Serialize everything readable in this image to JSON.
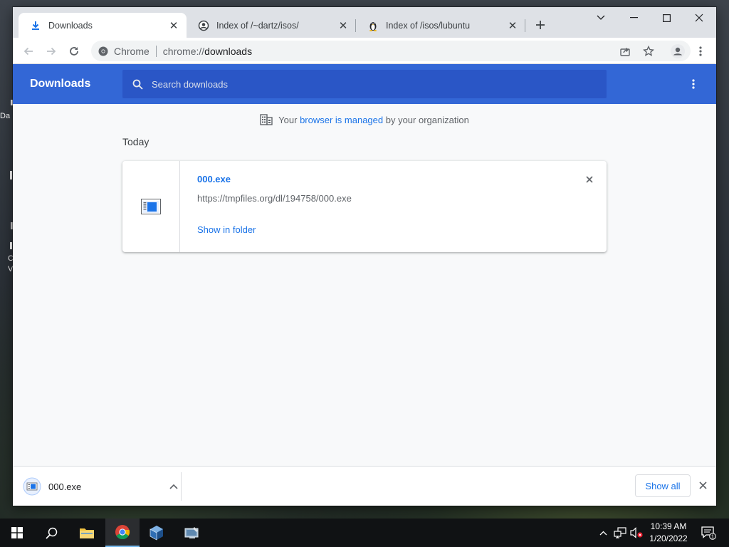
{
  "desktop": {
    "fragments": [
      "Da",
      "C",
      "V"
    ]
  },
  "tabs": [
    {
      "title": "Downloads",
      "icon": "download-icon",
      "active": true
    },
    {
      "title": "Index of /~dartz/isos/",
      "icon": "globe-avatar-icon",
      "active": false
    },
    {
      "title": "Index of /isos/lubuntu",
      "icon": "tux-penguin-icon",
      "active": false
    }
  ],
  "toolbar": {
    "site_label": "Chrome",
    "url_scheme": "chrome://",
    "url_host": "downloads"
  },
  "downloads_page": {
    "title": "Downloads",
    "search_placeholder": "Search downloads",
    "managed": {
      "prefix": "Your ",
      "link": "browser is managed",
      "suffix": " by your organization"
    },
    "date_header": "Today",
    "items": [
      {
        "filename": "000.exe",
        "url": "https://tmpfiles.org/dl/194758/000.exe",
        "action": "Show in folder"
      }
    ]
  },
  "shelf": {
    "item_name": "000.exe",
    "show_all": "Show all"
  },
  "taskbar": {
    "time": "10:39 AM",
    "date": "1/20/2022",
    "notification_count": "1"
  },
  "colors": {
    "header_blue": "#3367d6",
    "link_blue": "#1a73e8",
    "tabstrip_gray": "#dee1e6"
  }
}
